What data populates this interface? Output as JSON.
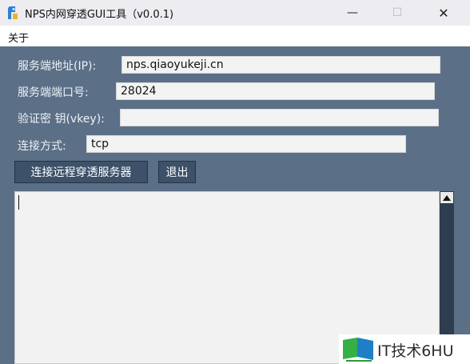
{
  "window": {
    "title": "NPS内网穿透GUI工具（v0.0.1)",
    "controls": {
      "minimize": "—",
      "maximize": "☐",
      "close": "✕"
    }
  },
  "menu": {
    "about": "关于"
  },
  "form": {
    "server_ip_label": "服务端地址(IP):",
    "server_ip_value": "nps.qiaoyukeji.cn",
    "server_port_label": "服务端端口号:",
    "server_port_value": "28024",
    "vkey_label": "验证密 钥(vkey):",
    "vkey_value": "",
    "connect_mode_label": "连接方式:",
    "connect_mode_value": "tcp"
  },
  "buttons": {
    "connect": "连接远程穿透服务器",
    "exit": "退出"
  },
  "log": {
    "content": ""
  },
  "watermark": {
    "text": "IT技术6HU"
  },
  "colors": {
    "background": "#5b6f87",
    "titlebar": "#ececf1",
    "button": "#3d5169",
    "scrollbar": "#2e3d4f"
  },
  "icons": {
    "app": "app-logo-icon",
    "scroll_up": "triangle-up-icon",
    "watermark": "green-flag-icon"
  }
}
